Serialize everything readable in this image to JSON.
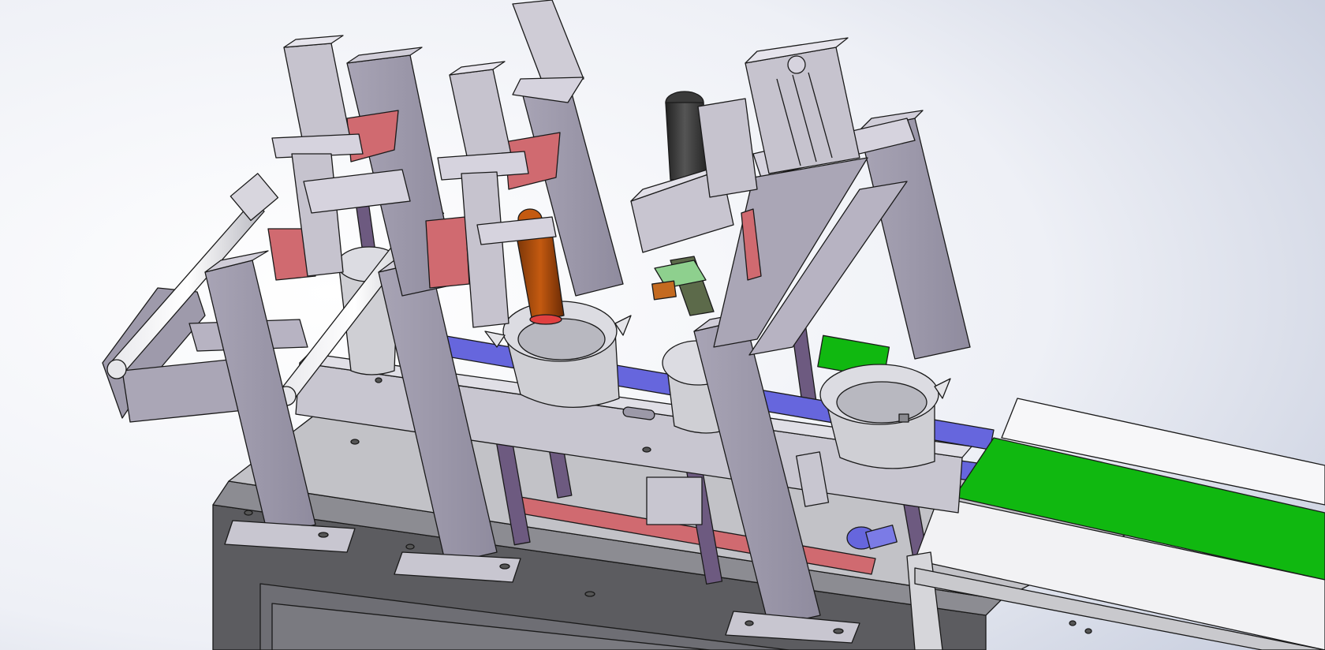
{
  "scene": {
    "colors": {
      "background_light": "#ffffff",
      "background_dark": "#cfd5e3",
      "frame_metal": "#a6a2b3",
      "frame_metal_light": "#d0cdd8",
      "frame_metal_dark": "#7d7a8a",
      "cabinet": "#5c5c60",
      "cabinet_top": "#c7c7cb",
      "red_slide": "#d06a70",
      "blue_rail": "#6666dd",
      "green_belt": "#10b810",
      "orange_cylinder": "#c45a10",
      "outline": "#1a1a1a"
    },
    "icons": [
      "cad-3d-model"
    ]
  }
}
